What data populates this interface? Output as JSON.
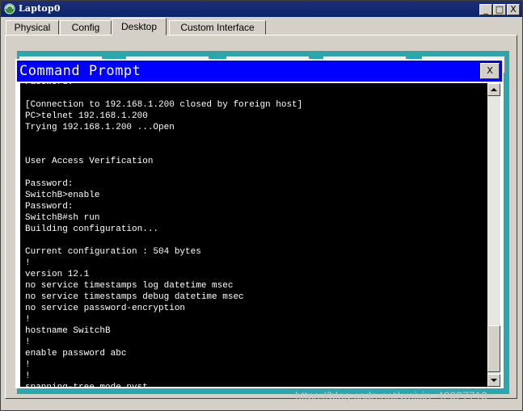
{
  "window": {
    "title": "Laptop0"
  },
  "window_controls": {
    "minimize": "_",
    "maximize": "□",
    "close": "X"
  },
  "tabs": [
    {
      "label": "Physical"
    },
    {
      "label": "Config"
    },
    {
      "label": "Desktop",
      "active": true
    },
    {
      "label": "Custom Interface"
    }
  ],
  "command_prompt": {
    "title": "Command Prompt",
    "close_label": "X",
    "lines": [
      "Password:",
      "",
      "[Connection to 192.168.1.200 closed by foreign host]",
      "PC>telnet 192.168.1.200",
      "Trying 192.168.1.200 ...Open",
      "",
      "",
      "User Access Verification",
      "",
      "Password:",
      "SwitchB>enable",
      "Password:",
      "SwitchB#sh run",
      "Building configuration...",
      "",
      "Current configuration : 504 bytes",
      "!",
      "version 12.1",
      "no service timestamps log datetime msec",
      "no service timestamps debug datetime msec",
      "no service password-encryption",
      "!",
      "hostname SwitchB",
      "!",
      "enable password abc",
      "!",
      "!",
      "spanning-tree mode pvst"
    ]
  },
  "watermark": "https://blog.csdn.net/weixin_42927719",
  "colors": {
    "cmd_titlebar": "#0000ff",
    "desktop": "#2aa6ad",
    "terminal_bg": "#000000"
  }
}
